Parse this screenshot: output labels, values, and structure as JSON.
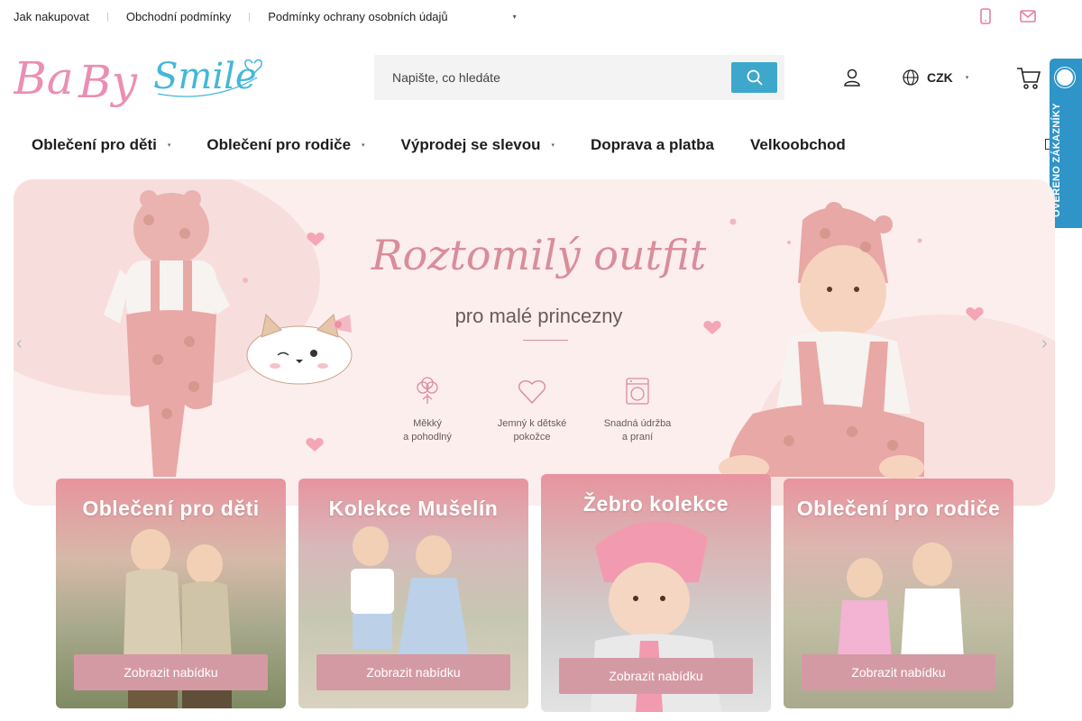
{
  "topbar": {
    "links": [
      "Jak nakupovat",
      "Obchodní podmínky",
      "Podmínky ochrany osobních údajů"
    ],
    "more_icon": "chevron-down-icon",
    "contact_icons": [
      "phone-icon",
      "mail-icon"
    ]
  },
  "header": {
    "logo_text": "BaBy Smile",
    "search": {
      "placeholder": "Napište, co hledáte"
    },
    "currency": "CZK"
  },
  "nav": {
    "items": [
      "Oblečení pro děti",
      "Oblečení pro rodiče",
      "Výprodej se slevou",
      "Doprava a platba",
      "Velkoobchod"
    ]
  },
  "badge": {
    "text": "OVĚŘENO ZÁKAZNÍKY"
  },
  "hero": {
    "title": "Roztomilý outfit",
    "subtitle": "pro malé princezny",
    "features": [
      {
        "line1": "Měkký",
        "line2": "a pohodlný",
        "icon": "cotton-icon"
      },
      {
        "line1": "Jemný k dětské",
        "line2": "pokožce",
        "icon": "heart-icon"
      },
      {
        "line1": "Snadná údržba",
        "line2": "a praní",
        "icon": "washing-machine-icon"
      }
    ]
  },
  "categories": [
    {
      "title": "Oblečení pro děti",
      "cta": "Zobrazit nabídku"
    },
    {
      "title": "Kolekce Mušelín",
      "cta": "Zobrazit nabídku"
    },
    {
      "title": "Žebro kolekce",
      "cta": "Zobrazit nabídku"
    },
    {
      "title": "Oblečení pro rodiče",
      "cta": "Zobrazit nabídku"
    }
  ],
  "colors": {
    "accent_blue": "#3ea7cc",
    "pink": "#d49aa3",
    "logo_pink": "#ea8fb3",
    "logo_blue": "#44b7d9"
  }
}
